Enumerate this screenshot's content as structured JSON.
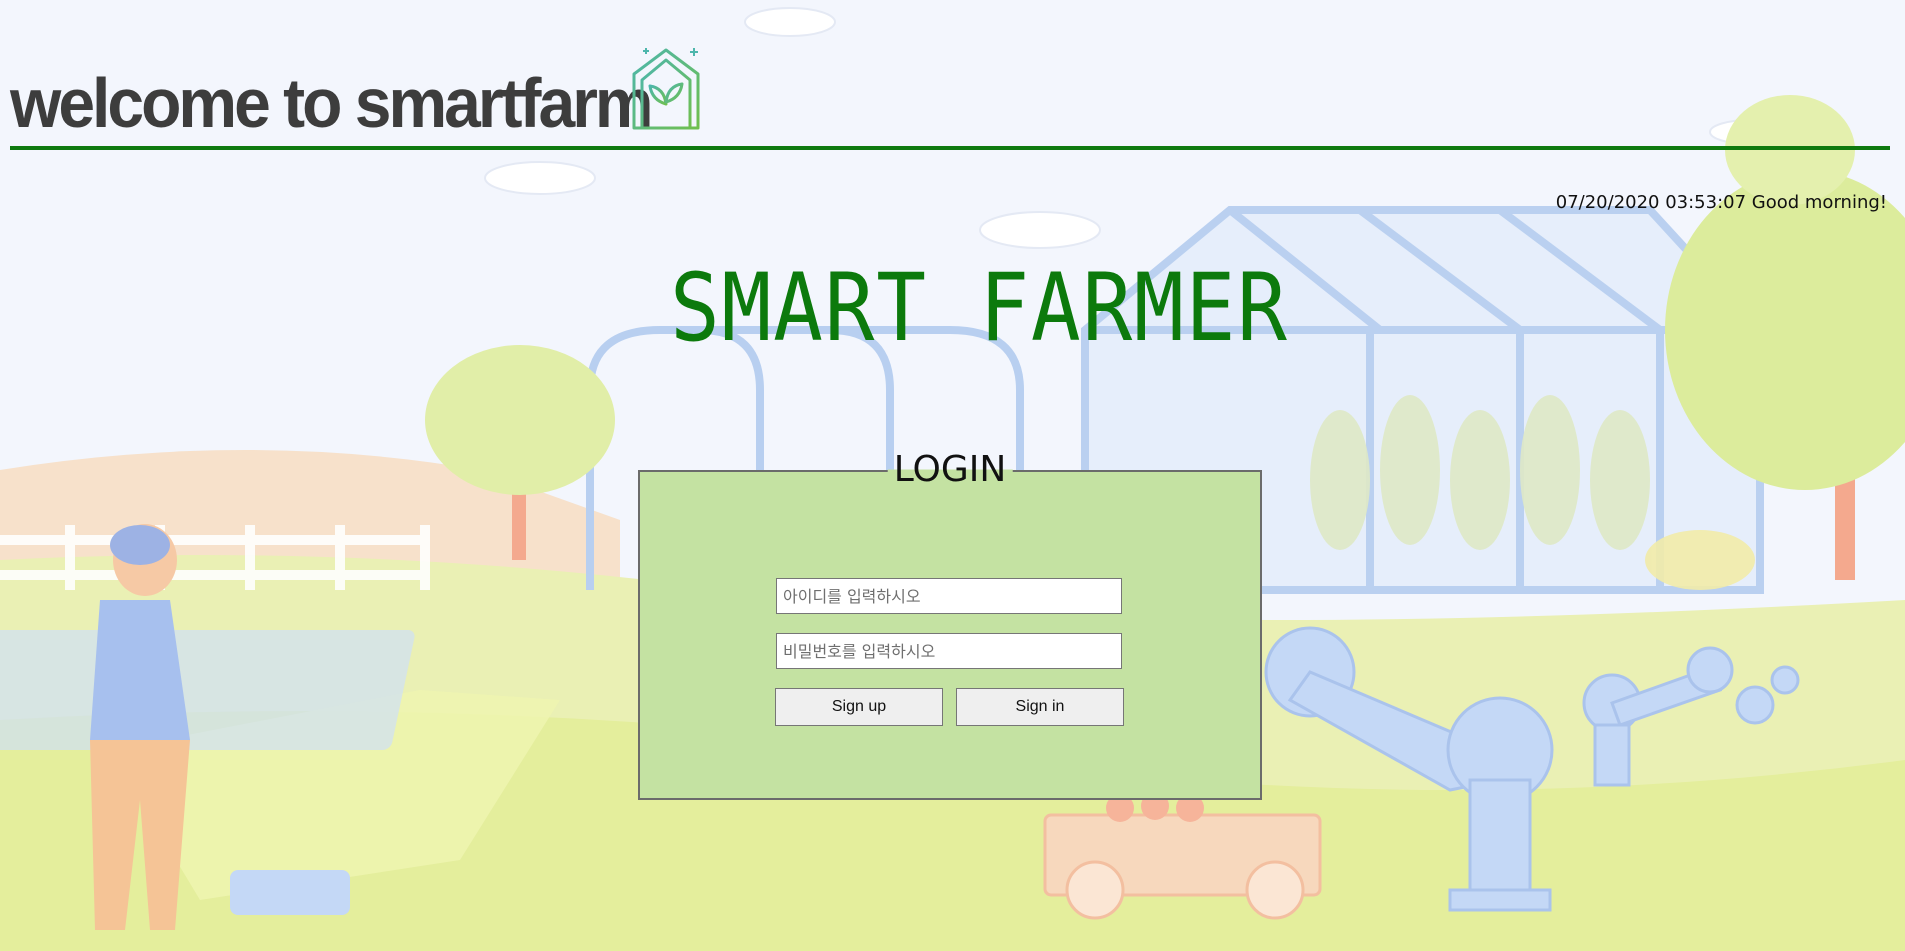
{
  "header": {
    "title": "welcome to smartfarm",
    "logo_icon": "smart-greenhouse-icon"
  },
  "status": {
    "datetime_greeting": "07/20/2020 03:53:07 Good morning!"
  },
  "brand": {
    "name": "SMART FARMER"
  },
  "login": {
    "legend": "LOGIN",
    "id_placeholder": "아이디를 입력하시오",
    "password_placeholder": "비밀번호를 입력하시오",
    "signup_label": "Sign up",
    "signin_label": "Sign in"
  },
  "colors": {
    "accent_green": "#0c7a0c",
    "header_rule": "#0f7a0f",
    "login_panel": "#c4e2a2",
    "title_text": "#3d3d3d"
  }
}
